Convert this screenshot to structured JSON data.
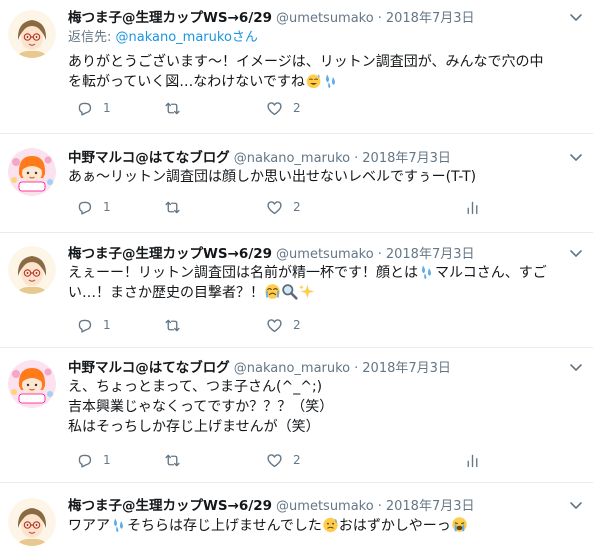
{
  "tweets": [
    {
      "name": "梅つま子@生理カップWS→6/29",
      "handle": "@umetsumako",
      "date": "2018年7月3日",
      "reply_prefix": "返信先: ",
      "reply_to": "@nakano_marukoさん",
      "lines": [
        "ありがとうございます〜！イメージは、リットン調査団が、みんなで穴の中",
        "を転がっていく図…なわけないですね"
      ],
      "reply_count": "1",
      "retweet_count": "",
      "like_count": "2"
    },
    {
      "name": "中野マルコ@はてなブログ",
      "handle": "@nakano_maruko",
      "date": "2018年7月3日",
      "lines": [
        "あぁ〜リットン調査団は顔しか思い出せないレベルですぅー(T-T)"
      ],
      "reply_count": "1",
      "retweet_count": "",
      "like_count": "2"
    },
    {
      "name": "梅つま子@生理カップWS→6/29",
      "handle": "@umetsumako",
      "date": "2018年7月3日",
      "lines": [
        "えぇーー！リットン調査団は名前が精一杯です！顔とは",
        "マルコさん、すご",
        "い…！まさか歴史の目撃者？！"
      ],
      "reply_count": "1",
      "retweet_count": "",
      "like_count": "2"
    },
    {
      "name": "中野マルコ@はてなブログ",
      "handle": "@nakano_maruko",
      "date": "2018年7月3日",
      "lines": [
        "え、ちょっとまって、つま子さん(^_^;)",
        "吉本興業じゃなくってですか？？？（笑）",
        "私はそっちしか存じ上げませんが（笑）"
      ],
      "reply_count": "1",
      "retweet_count": "",
      "like_count": "2"
    },
    {
      "name": "梅つま子@生理カップWS→6/29",
      "handle": "@umetsumako",
      "date": "2018年7月3日",
      "lines": [
        "ワアア",
        "そちらは存じ上げませんでした",
        "おはずかしやーっ"
      ]
    }
  ],
  "avatar_labels": {
    "maruko": "maruko"
  },
  "colors": {
    "secondary": "#657786",
    "link": "#1b95e0",
    "divider": "#e6ecf0"
  },
  "icons": [
    "reply-icon",
    "retweet-icon",
    "like-icon",
    "analytics-icon",
    "caret-down-icon"
  ]
}
